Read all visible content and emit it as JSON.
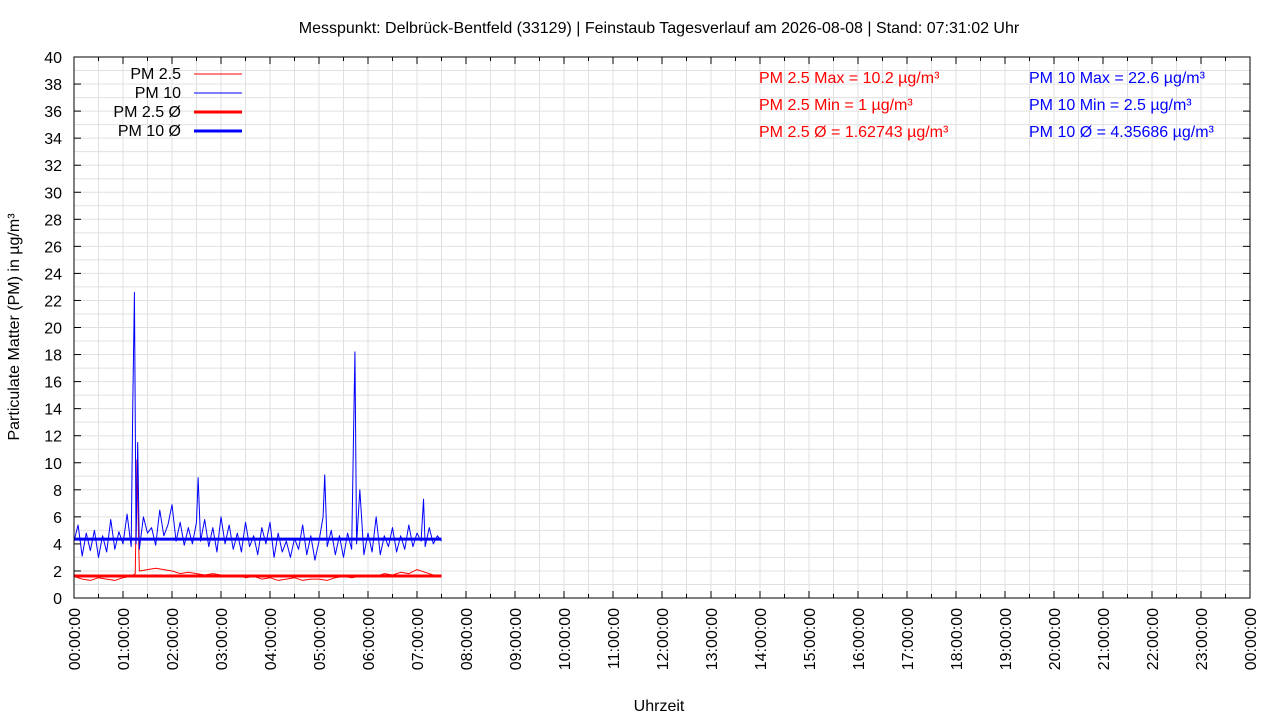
{
  "chart_data": {
    "type": "line",
    "title": "Messpunkt: Delbrück-Bentfeld (33129) | Feinstaub Tagesverlauf am 2026-08-08 | Stand: 07:31:02 Uhr",
    "xlabel": "Uhrzeit",
    "ylabel": "Particulate Matter (PM) in µg/m³",
    "xlim": [
      "00:00:00",
      "24:00:00"
    ],
    "ylim": [
      0,
      40
    ],
    "grid": true,
    "legend_position": "top-left",
    "x_ticks": [
      "00:00:00",
      "01:00:00",
      "02:00:00",
      "03:00:00",
      "04:00:00",
      "05:00:00",
      "06:00:00",
      "07:00:00",
      "08:00:00",
      "09:00:00",
      "10:00:00",
      "11:00:00",
      "12:00:00",
      "13:00:00",
      "14:00:00",
      "15:00:00",
      "16:00:00",
      "17:00:00",
      "18:00:00",
      "19:00:00",
      "20:00:00",
      "21:00:00",
      "22:00:00",
      "23:00:00",
      "00:00:00"
    ],
    "y_ticks": [
      0,
      2,
      4,
      6,
      8,
      10,
      12,
      14,
      16,
      18,
      20,
      22,
      24,
      26,
      28,
      30,
      32,
      34,
      36,
      38,
      40
    ],
    "series": [
      {
        "name": "PM 2.5",
        "color": "#ff0000",
        "style": "thin",
        "x": [
          "00:00",
          "00:10",
          "00:20",
          "00:30",
          "00:40",
          "00:50",
          "01:00",
          "01:10",
          "01:15",
          "01:17",
          "01:20",
          "01:30",
          "01:40",
          "01:50",
          "02:00",
          "02:10",
          "02:20",
          "02:30",
          "02:40",
          "02:50",
          "03:00",
          "03:10",
          "03:20",
          "03:30",
          "03:40",
          "03:50",
          "04:00",
          "04:10",
          "04:20",
          "04:30",
          "04:40",
          "04:50",
          "05:00",
          "05:10",
          "05:20",
          "05:30",
          "05:40",
          "05:50",
          "06:00",
          "06:10",
          "06:20",
          "06:30",
          "06:40",
          "06:50",
          "07:00",
          "07:10",
          "07:20",
          "07:30"
        ],
        "y": [
          1.6,
          1.4,
          1.3,
          1.5,
          1.4,
          1.3,
          1.5,
          1.6,
          1.8,
          10.2,
          2.0,
          2.1,
          2.2,
          2.1,
          2.0,
          1.8,
          1.9,
          1.8,
          1.7,
          1.8,
          1.7,
          1.6,
          1.7,
          1.5,
          1.6,
          1.4,
          1.5,
          1.3,
          1.4,
          1.5,
          1.3,
          1.4,
          1.4,
          1.3,
          1.5,
          1.6,
          1.5,
          1.6,
          1.7,
          1.6,
          1.8,
          1.7,
          1.9,
          1.8,
          2.1,
          1.9,
          1.7,
          1.6
        ]
      },
      {
        "name": "PM 10",
        "color": "#0000ff",
        "style": "thin",
        "x": [
          "00:00",
          "00:05",
          "00:10",
          "00:15",
          "00:20",
          "00:25",
          "00:30",
          "00:35",
          "00:40",
          "00:45",
          "00:50",
          "00:55",
          "01:00",
          "01:05",
          "01:10",
          "01:12",
          "01:14",
          "01:16",
          "01:18",
          "01:20",
          "01:25",
          "01:30",
          "01:35",
          "01:40",
          "01:45",
          "01:50",
          "01:55",
          "02:00",
          "02:05",
          "02:10",
          "02:15",
          "02:20",
          "02:25",
          "02:30",
          "02:32",
          "02:35",
          "02:40",
          "02:45",
          "02:50",
          "02:55",
          "03:00",
          "03:05",
          "03:10",
          "03:15",
          "03:20",
          "03:25",
          "03:30",
          "03:35",
          "03:40",
          "03:45",
          "03:50",
          "03:55",
          "04:00",
          "04:05",
          "04:10",
          "04:15",
          "04:20",
          "04:25",
          "04:30",
          "04:35",
          "04:40",
          "04:45",
          "04:50",
          "04:55",
          "05:00",
          "05:05",
          "05:07",
          "05:10",
          "05:15",
          "05:20",
          "05:25",
          "05:30",
          "05:35",
          "05:40",
          "05:42",
          "05:44",
          "05:46",
          "05:50",
          "05:55",
          "06:00",
          "06:05",
          "06:10",
          "06:15",
          "06:20",
          "06:25",
          "06:30",
          "06:35",
          "06:40",
          "06:45",
          "06:50",
          "06:55",
          "07:00",
          "07:05",
          "07:08",
          "07:10",
          "07:15",
          "07:20",
          "07:25",
          "07:30"
        ],
        "y": [
          4.2,
          5.4,
          3.1,
          4.8,
          3.5,
          5.0,
          3.0,
          4.6,
          3.4,
          5.8,
          3.6,
          4.9,
          4.0,
          6.2,
          3.8,
          14.4,
          22.6,
          4.0,
          11.5,
          3.6,
          6.0,
          4.8,
          5.2,
          3.9,
          6.5,
          4.6,
          5.4,
          6.9,
          4.2,
          5.6,
          3.9,
          5.2,
          4.0,
          5.6,
          8.9,
          4.2,
          5.8,
          3.8,
          5.2,
          3.4,
          6.0,
          4.0,
          5.4,
          3.6,
          4.8,
          3.4,
          5.6,
          3.8,
          4.6,
          3.2,
          5.2,
          4.0,
          5.6,
          3.0,
          4.8,
          3.4,
          4.2,
          3.0,
          4.4,
          3.6,
          5.4,
          3.2,
          4.6,
          2.8,
          4.2,
          6.0,
          9.1,
          3.8,
          5.0,
          3.2,
          4.6,
          3.0,
          4.8,
          3.6,
          11.0,
          18.2,
          4.0,
          8.0,
          3.2,
          4.8,
          3.4,
          6.0,
          3.2,
          4.6,
          3.8,
          5.2,
          3.4,
          4.6,
          3.6,
          5.4,
          3.8,
          4.8,
          4.2,
          7.3,
          3.8,
          5.2,
          4.0,
          4.6,
          4.2
        ]
      },
      {
        "name": "PM 2.5 Ø",
        "color": "#ff0000",
        "style": "thick",
        "x": [
          "00:00",
          "07:30"
        ],
        "y": [
          1.62743,
          1.62743
        ]
      },
      {
        "name": "PM 10 Ø",
        "color": "#0000ff",
        "style": "thick",
        "x": [
          "00:00",
          "07:30"
        ],
        "y": [
          4.35686,
          4.35686
        ]
      }
    ],
    "annotations": {
      "pm25_max": "PM 2.5 Max = 10.2 µg/m³",
      "pm25_min": "PM 2.5 Min = 1 µg/m³",
      "pm25_avg": "PM 2.5 Ø = 1.62743 µg/m³",
      "pm10_max": "PM 10 Max = 22.6 µg/m³",
      "pm10_min": "PM 10 Min = 2.5 µg/m³",
      "pm10_avg": "PM 10 Ø = 4.35686 µg/m³"
    }
  },
  "colors": {
    "pm25": "#ff0000",
    "pm10": "#0000ff",
    "grid": "#e0e0e0",
    "axis": "#000000"
  }
}
